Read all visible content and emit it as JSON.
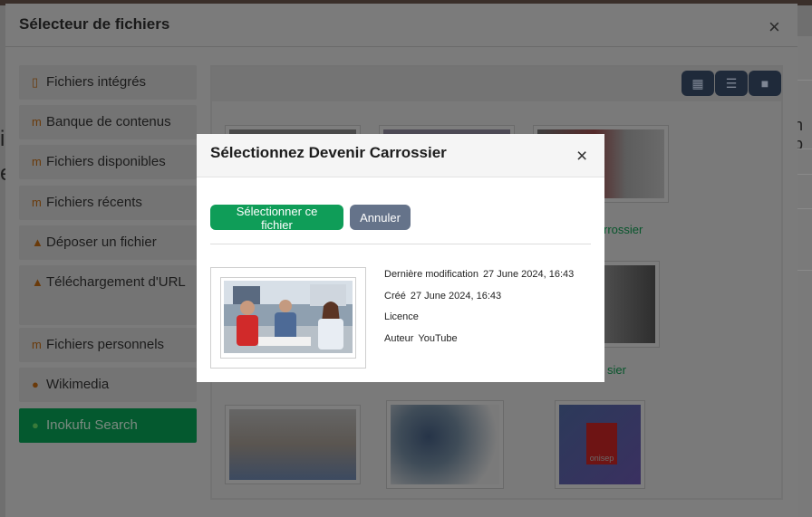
{
  "outer": {
    "title": "Sélecteur de fichiers",
    "close": "×"
  },
  "sidebar": {
    "items": [
      {
        "label": "Fichiers intégrés",
        "icon": "file-embedded-icon"
      },
      {
        "label": "Banque de contenus",
        "icon": "moodle-icon"
      },
      {
        "label": "Fichiers disponibles",
        "icon": "moodle-icon"
      },
      {
        "label": "Fichiers récents",
        "icon": "moodle-icon"
      },
      {
        "label": "Déposer un fichier",
        "icon": "upload-icon"
      },
      {
        "label": "Téléchargement d'URL",
        "icon": "download-url-icon"
      },
      {
        "label": "Fichiers personnels",
        "icon": "moodle-icon"
      },
      {
        "label": "Wikimedia",
        "icon": "wikimedia-icon"
      },
      {
        "label": "Inokufu Search",
        "icon": "inokufu-icon"
      }
    ]
  },
  "view_buttons": [
    "grid-view-icon",
    "list-view-icon",
    "folder-view-icon"
  ],
  "thumbnails": {
    "label_1": "rrossier",
    "label_2": "sier",
    "onisep_text": "onisep"
  },
  "modal": {
    "title": "Sélectionnez Devenir Carrossier",
    "close": "×",
    "select_label": "Sélectionner ce fichier",
    "cancel_label": "Annuler",
    "meta": {
      "modified_label": "Dernière modification",
      "modified_value": "27 June 2024, 16:43",
      "created_label": "Créé",
      "created_value": "27 June 2024, 16:43",
      "license_label": "Licence",
      "author_label": "Auteur",
      "author_value": "YouTube"
    }
  },
  "background": {
    "right_fragment": "n b",
    "left_fragment_1": "i",
    "left_fragment_2": "e"
  },
  "colors": {
    "primary_green": "#0f9d58",
    "secondary": "#65738a",
    "overlay": "#6f6f6f"
  }
}
